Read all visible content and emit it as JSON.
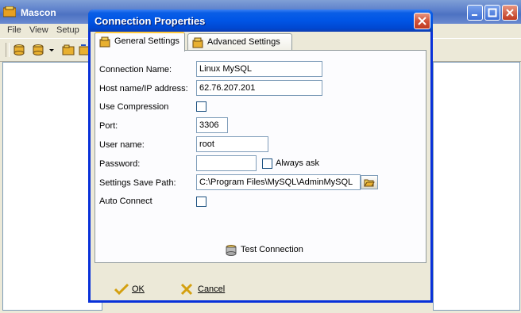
{
  "app": {
    "title": "Mascon",
    "menu": [
      "File",
      "View",
      "Setup"
    ]
  },
  "dialog": {
    "title": "Connection Properties",
    "tabs": [
      {
        "label": "General Settings",
        "icon": "db-settings-icon",
        "active": true
      },
      {
        "label": "Advanced Settings",
        "icon": "db-advanced-icon",
        "active": false
      }
    ],
    "fields": {
      "connection_name": {
        "label": "Connection Name:",
        "value": "Linux MySQL"
      },
      "host": {
        "label": "Host name/IP address:",
        "value": "62.76.207.201"
      },
      "use_compression": {
        "label": "Use Compression",
        "checked": false
      },
      "port": {
        "label": "Port:",
        "value": "3306"
      },
      "user_name": {
        "label": "User name:",
        "value": "root"
      },
      "password": {
        "label": "Password:",
        "value": ""
      },
      "always_ask": {
        "label": "Always ask",
        "checked": false
      },
      "save_path": {
        "label": "Settings Save Path:",
        "value": "C:\\Program Files\\MySQL\\AdminMySQL"
      },
      "auto_connect": {
        "label": "Auto Connect",
        "checked": false
      }
    },
    "test_connection_label": "Test Connection",
    "ok_label": "OK",
    "cancel_label": "Cancel"
  },
  "colors": {
    "dialog_title": "#0055e5",
    "face": "#ece9d8",
    "active_tab_accent": "#ffc83c"
  }
}
